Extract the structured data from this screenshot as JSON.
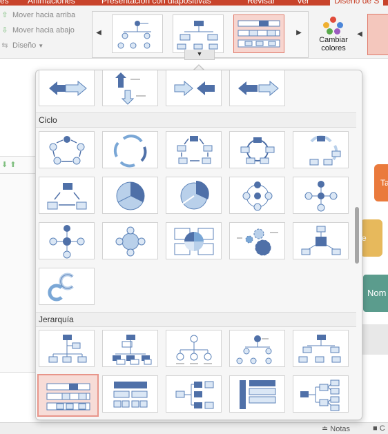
{
  "tabs": [
    {
      "label": "es"
    },
    {
      "label": "Animaciones"
    },
    {
      "label": "Presentación con diapositivas"
    },
    {
      "label": "Revisar"
    },
    {
      "label": "Ver"
    },
    {
      "label": "Diseño de S"
    }
  ],
  "ribbon": {
    "move_up": "Mover hacia arriba",
    "move_down": "Mover hacia abajo",
    "design": "Diseño",
    "change_colors_line1": "Cambiar",
    "change_colors_line2": "colores"
  },
  "gallery": {
    "sections": [
      {
        "title": "Ciclo"
      },
      {
        "title": "Jerarquía"
      }
    ],
    "selected": "Jerarquía con etiquetas"
  },
  "slide": {
    "shape_labels": [
      "Ta",
      "e",
      "Nom"
    ]
  },
  "statusbar": {
    "notes": "Notas",
    "comments": "C"
  },
  "colors": {
    "accent": "#c8432b",
    "node_dark": "#4f70a8",
    "node_light": "#dbe7f5",
    "node_outline": "#5b82b8",
    "selection": "#e8958a"
  }
}
